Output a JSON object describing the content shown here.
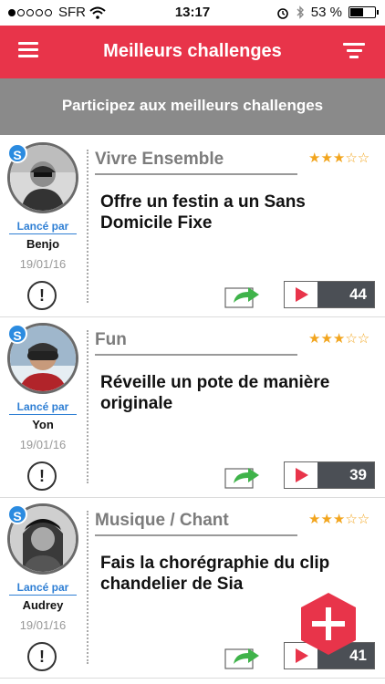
{
  "status_bar": {
    "carrier": "SFR",
    "time": "13:17",
    "battery": "53 %",
    "battery_level": 0.53
  },
  "header": {
    "title": "Meilleurs challenges"
  },
  "banner": {
    "text": "Participez aux meilleurs challenges"
  },
  "challenges": [
    {
      "category": "Vivre Ensemble",
      "title": "Offre un festin a un Sans Domicile Fixe",
      "launched_label": "Lancé par",
      "user": "Benjo",
      "date": "19/01/16",
      "rating": 3,
      "views": "44"
    },
    {
      "category": "Fun",
      "title": "Réveille un pote de manière originale",
      "launched_label": "Lancé par",
      "user": "Yon",
      "date": "19/01/16",
      "rating": 3,
      "views": "39"
    },
    {
      "category": "Musique / Chant",
      "title": "Fais la chorégraphie du clip chandelier de Sia",
      "launched_label": "Lancé par",
      "user": "Audrey",
      "date": "19/01/16",
      "rating": 3,
      "views": "41"
    }
  ],
  "colors": {
    "brand_red": "#e8344a",
    "banner_gray": "#8a8a8a",
    "star_orange": "#f2a51e",
    "badge_blue": "#2b8be0",
    "launched_blue": "#2f7fd4",
    "count_dark": "#4b4f55",
    "share_green": "#3fb34a"
  }
}
